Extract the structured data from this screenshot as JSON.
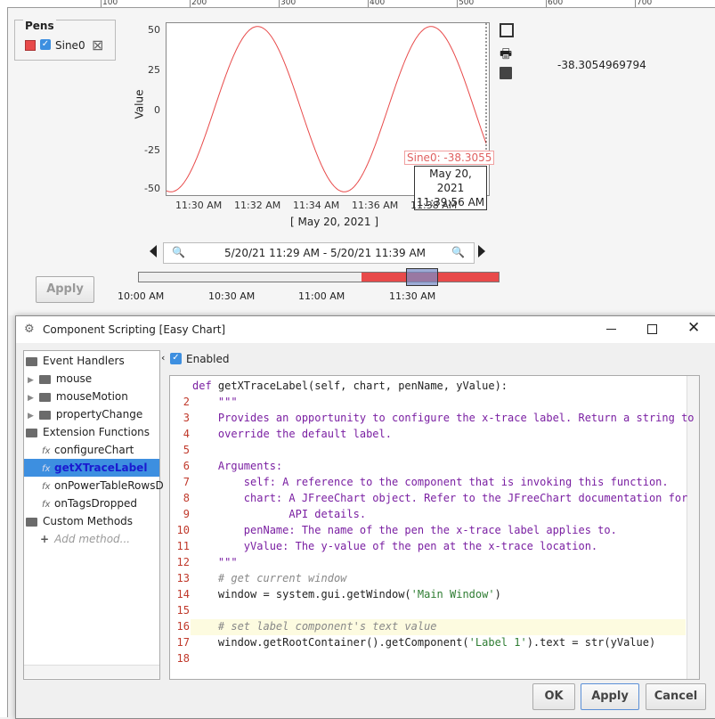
{
  "ruler": {
    "labels": [
      "100",
      "200",
      "300",
      "400",
      "500",
      "600",
      "700"
    ]
  },
  "pens": {
    "title": "Pens",
    "items": [
      {
        "name": "Sine0",
        "color": "#e84a4a",
        "checked": true
      }
    ]
  },
  "chart_data": {
    "type": "line",
    "ylabel": "Value",
    "yticks": [
      "50",
      "25",
      "0",
      "-25",
      "-50"
    ],
    "ylim": [
      -52,
      52
    ],
    "xticks": [
      "11:30 AM",
      "11:32 AM",
      "11:34 AM",
      "11:36 AM",
      "11:38 AM"
    ],
    "date_label": "[ May 20, 2021 ]",
    "series": [
      {
        "name": "Sine0",
        "color": "#e84a4a",
        "amplitude": 50,
        "period_minutes": 6,
        "peak_times": [
          "11:32 AM",
          "11:38 AM"
        ]
      }
    ],
    "trace": {
      "label": "Sine0: -38.3055",
      "date": "May 20, 2021",
      "time": "11:39:56 AM"
    }
  },
  "value_label": "-38.3054969794",
  "range": {
    "text": "5/20/21 11:29 AM - 5/20/21 11:39 AM",
    "slider_labels": [
      "10:00 AM",
      "10:30 AM",
      "11:00 AM",
      "11:30 AM"
    ]
  },
  "apply_top": "Apply",
  "dialog": {
    "title": "Component Scripting [Easy Chart]",
    "enabled_label": "Enabled",
    "tree": {
      "event_handlers": "Event Handlers",
      "events": [
        "mouse",
        "mouseMotion",
        "propertyChange"
      ],
      "extension_functions": "Extension Functions",
      "functions": [
        "configureChart",
        "getXTraceLabel",
        "onPowerTableRowsD",
        "onTagsDropped"
      ],
      "custom_methods": "Custom Methods",
      "add_method": "Add method..."
    },
    "code_lines": [
      {
        "n": "",
        "t": "def getXTraceLabel(self, chart, penName, yValue):"
      },
      {
        "n": "2",
        "t": "    \"\"\""
      },
      {
        "n": "3",
        "t": "    Provides an opportunity to configure the x-trace label. Return a string to"
      },
      {
        "n": "4",
        "t": "    override the default label."
      },
      {
        "n": "5",
        "t": ""
      },
      {
        "n": "6",
        "t": "    Arguments:"
      },
      {
        "n": "7",
        "t": "        self: A reference to the component that is invoking this function."
      },
      {
        "n": "8",
        "t": "        chart: A JFreeChart object. Refer to the JFreeChart documentation for"
      },
      {
        "n": "9",
        "t": "               API details."
      },
      {
        "n": "10",
        "t": "        penName: The name of the pen the x-trace label applies to."
      },
      {
        "n": "11",
        "t": "        yValue: The y-value of the pen at the x-trace location."
      },
      {
        "n": "12",
        "t": "    \"\"\""
      },
      {
        "n": "13",
        "t": "    # get current window"
      },
      {
        "n": "14",
        "t": "    window = system.gui.getWindow('Main Window')"
      },
      {
        "n": "15",
        "t": ""
      },
      {
        "n": "16",
        "t": "    # set label component's text value"
      },
      {
        "n": "17",
        "t": "    window.getRootContainer().getComponent('Label 1').text = str(yValue)"
      },
      {
        "n": "18",
        "t": ""
      }
    ],
    "buttons": {
      "ok": "OK",
      "apply": "Apply",
      "cancel": "Cancel"
    }
  }
}
